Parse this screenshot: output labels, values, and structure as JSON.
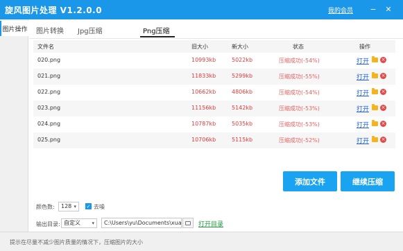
{
  "window": {
    "title": "旋风图片处理 V1.2.0.0",
    "member_link": "我的会员",
    "minimize_glyph": "−",
    "close_glyph": "✕"
  },
  "sidebar": {
    "items": [
      {
        "label": "图片操作"
      }
    ]
  },
  "tabs": [
    {
      "label": "图片转换"
    },
    {
      "label": "Jpg压缩"
    },
    {
      "label": "Png压缩",
      "active": true
    }
  ],
  "table": {
    "headers": {
      "name": "文件名",
      "old_size": "旧大小",
      "new_size": "新大小",
      "status": "状态",
      "action": "操作"
    },
    "rows": [
      {
        "name": "020.png",
        "old_size": "10993kb",
        "new_size": "5022kb",
        "status": "压缩成功(-54%)",
        "open": "打开"
      },
      {
        "name": "021.png",
        "old_size": "11833kb",
        "new_size": "5299kb",
        "status": "压缩成功(-55%)",
        "open": "打开"
      },
      {
        "name": "022.png",
        "old_size": "10662kb",
        "new_size": "4806kb",
        "status": "压缩成功(-54%)",
        "open": "打开"
      },
      {
        "name": "023.png",
        "old_size": "11156kb",
        "new_size": "5142kb",
        "status": "压缩成功(-53%)",
        "open": "打开"
      },
      {
        "name": "024.png",
        "old_size": "10787kb",
        "new_size": "5035kb",
        "status": "压缩成功(-53%)",
        "open": "打开"
      },
      {
        "name": "025.png",
        "old_size": "10706kb",
        "new_size": "5115kb",
        "status": "压缩成功(-52%)",
        "open": "打开"
      }
    ]
  },
  "actions": {
    "add_file": "添加文件",
    "continue_compress": "继续压缩"
  },
  "options": {
    "colors_label": "颜色数:",
    "colors_value": "128",
    "dither_label": "去噪",
    "dither_checked": true,
    "output_label": "输出目录:",
    "output_mode": "自定义",
    "output_path": "C:\\Users\\yu\\Documents\\xuanfe",
    "open_dir": "打开目录"
  },
  "statusbar": {
    "tip": "提示在尽量不减少图片质量的情况下，压缩图片的大小"
  },
  "colors": {
    "accent": "#1a97e8",
    "button": "#1aa3f0",
    "size_red": "#e23a3a",
    "link_green": "#1b9a3c"
  }
}
